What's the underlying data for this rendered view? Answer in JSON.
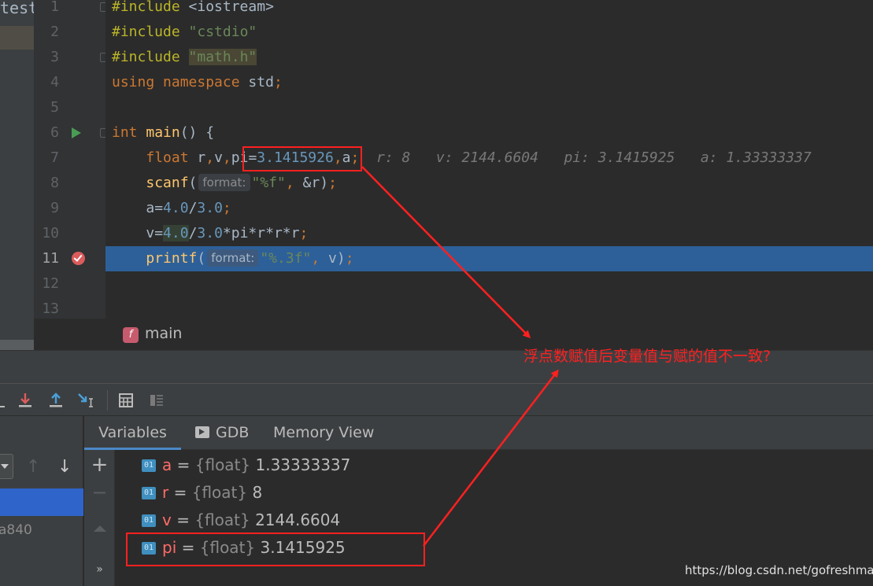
{
  "project_label": "test",
  "editor": {
    "lines": [
      {
        "num": "1"
      },
      {
        "num": "2"
      },
      {
        "num": "3"
      },
      {
        "num": "4"
      },
      {
        "num": "5"
      },
      {
        "num": "6"
      },
      {
        "num": "7"
      },
      {
        "num": "8"
      },
      {
        "num": "9"
      },
      {
        "num": "10"
      },
      {
        "num": "11"
      },
      {
        "num": "12"
      },
      {
        "num": "13"
      }
    ],
    "code": {
      "l1": {
        "pp": "#include",
        "rest": " <iostream>"
      },
      "l2": {
        "pp": "#include",
        "str": "\"cstdio\""
      },
      "l3": {
        "pp": "#include",
        "str": "\"math.h\""
      },
      "l4": {
        "kw1": "using",
        "kw2": "namespace",
        "rest": " std",
        "semi": ";"
      },
      "l6": {
        "kw": "int",
        "fn": "main",
        "rest": "() {"
      },
      "l7": {
        "kw": "float",
        "a": " r",
        "c1": ",",
        "b": "v",
        "c2": ",",
        "pi": "pi=",
        "num": "3.1415926",
        "c3": ",",
        "d": "a",
        "semi": ";",
        "inline": "r: 8   v: 2144.6604   pi: 3.1415925   a: 1.33333337"
      },
      "l8": {
        "fn": "scanf",
        "open": "(",
        "hint": "format:",
        "str": "\"%f\"",
        "c": ",",
        "rest": " &r",
        "close": ")",
        "semi": ";"
      },
      "l9": {
        "a": "a=",
        "n1": "4.0",
        "div": "/",
        "n2": "3.0",
        "semi": ";"
      },
      "l10": {
        "v": "v=",
        "n1": "4.0",
        "div": "/",
        "n2": "3.0",
        "rest": "*pi*r*r*r",
        "semi": ";"
      },
      "l11": {
        "fn": "printf",
        "open": "(",
        "hint": "format:",
        "str": "\"%.3f\"",
        "c": ",",
        "rest": " v",
        "close": ")",
        "semi": ";"
      }
    }
  },
  "breadcrumb": {
    "badge": "f",
    "label": "main"
  },
  "debug": {
    "tabs": [
      {
        "label": "Variables"
      },
      {
        "label": "GDB"
      },
      {
        "label": "Memory View"
      }
    ],
    "frames": {
      "second": "a840",
      "up_arrow": "↑",
      "down_arrow": "↓"
    },
    "var_toolbar": {
      "add": "+",
      "remove": "−",
      "more": "»"
    },
    "variables": [
      {
        "icon": "01",
        "name": "a",
        "eq": " = ",
        "type": "{float}",
        "value": " 1.33333337"
      },
      {
        "icon": "01",
        "name": "r",
        "eq": " = ",
        "type": "{float}",
        "value": " 8"
      },
      {
        "icon": "01",
        "name": "v",
        "eq": " = ",
        "type": "{float}",
        "value": " 2144.6604"
      },
      {
        "icon": "01",
        "name": "pi",
        "eq": " = ",
        "type": "{float}",
        "value": " 3.1415925"
      }
    ]
  },
  "annotation": "浮点数赋值后变量值与赋的值不一致?",
  "watermark": "https://blog.csdn.net/gofreshman",
  "colors": {
    "accent": "#2d6099",
    "annotation": "#ff2020",
    "keyword": "#cc7832",
    "string": "#6a8759",
    "number": "#6897bb"
  }
}
